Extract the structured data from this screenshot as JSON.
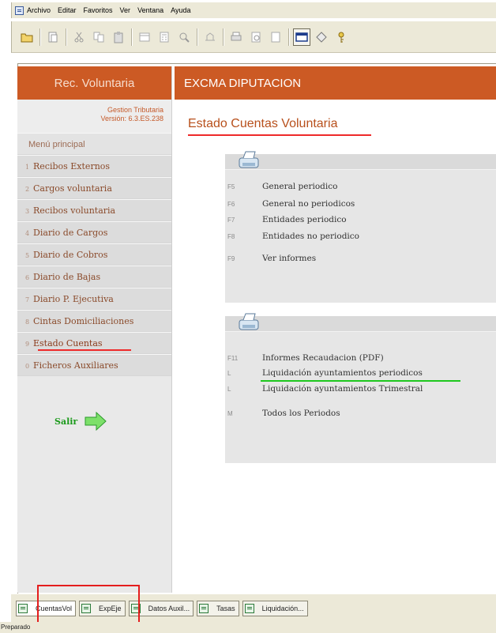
{
  "menubar": {
    "items": [
      "Archivo",
      "Editar",
      "Favoritos",
      "Ver",
      "Ventana",
      "Ayuda"
    ]
  },
  "toolbar": {
    "buttons": [
      "open-folder-icon",
      "copy-page-icon",
      "cut-icon",
      "copy-icon",
      "paste-icon",
      "print-preview-icon",
      "calculator-icon",
      "search-icon",
      "connect-icon",
      "printer-icon",
      "document-preview-icon",
      "page-icon",
      "window-icon",
      "tag-icon",
      "help-key-icon"
    ]
  },
  "sidebar": {
    "header": "Rec. Voluntaria",
    "app_name": "Gestion Tributaria",
    "version": "Versión: 6.3.ES.238",
    "menu_title": "Menú principal",
    "items": [
      {
        "num": "1",
        "label": "Recibos Externos"
      },
      {
        "num": "2",
        "label": "Cargos voluntaria"
      },
      {
        "num": "3",
        "label": "Recibos voluntaria"
      },
      {
        "num": "4",
        "label": "Diario de Cargos"
      },
      {
        "num": "5",
        "label": "Diario de Cobros"
      },
      {
        "num": "6",
        "label": "Diario de Bajas"
      },
      {
        "num": "7",
        "label": "Diario P. Ejecutiva"
      },
      {
        "num": "8",
        "label": "Cintas Domiciliaciones"
      },
      {
        "num": "9",
        "label": "Estado Cuentas"
      },
      {
        "num": "0",
        "label": "Ficheros Auxiliares"
      }
    ],
    "exit_label": "Salir"
  },
  "content": {
    "header": "EXCMA DIPUTACION",
    "title": "Estado Cuentas Voluntaria",
    "panel1": [
      {
        "key": "F5",
        "label": "General periodico"
      },
      {
        "key": "F6",
        "label": "General no periodicos"
      },
      {
        "key": "F7",
        "label": "Entidades periodico"
      },
      {
        "key": "F8",
        "label": "Entidades no periodico"
      },
      {
        "key": "F9",
        "label": "Ver informes"
      }
    ],
    "panel2": [
      {
        "key": "F11",
        "label": "Informes Recaudacion (PDF)"
      },
      {
        "key": "L",
        "label": "Liquidación ayuntamientos periodicos"
      },
      {
        "key": "L",
        "label": "Liquidación ayuntamientos Trimestral"
      },
      {
        "key": "M",
        "label": "Todos los Periodos"
      }
    ]
  },
  "taskbar": {
    "tasks": [
      {
        "label": "CuentasVol"
      },
      {
        "label": "ExpEje"
      },
      {
        "label": "Datos Auxil..."
      },
      {
        "label": "Tasas"
      },
      {
        "label": "Liquidación..."
      }
    ]
  },
  "status": {
    "text": "Preparado"
  },
  "colors": {
    "accent": "#cc5a24",
    "highlight_red": "#ee2a2a",
    "highlight_green": "#1ec81e"
  }
}
